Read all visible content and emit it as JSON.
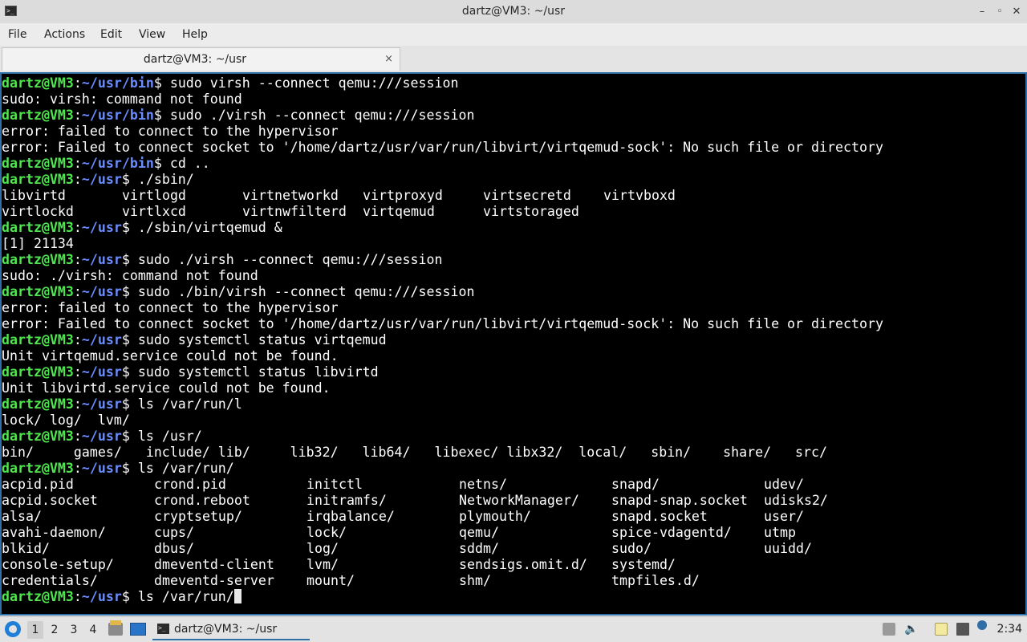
{
  "window": {
    "title": "dartz@VM3: ~/usr",
    "icon": "terminal-icon",
    "controls": [
      "minimize-icon",
      "maximize-icon",
      "close-icon"
    ]
  },
  "menu": {
    "file": "File",
    "actions": "Actions",
    "edit": "Edit",
    "view": "View",
    "help": "Help"
  },
  "tab": {
    "label": "dartz@VM3: ~/usr",
    "close": "×"
  },
  "terminal": {
    "lines": [
      {
        "type": "prompt",
        "user": "dartz@VM3",
        "path": "~/usr/bin",
        "cmd": "sudo virsh --connect qemu:///session"
      },
      {
        "type": "out",
        "text": "sudo: virsh: command not found"
      },
      {
        "type": "prompt",
        "user": "dartz@VM3",
        "path": "~/usr/bin",
        "cmd": "sudo ./virsh --connect qemu:///session"
      },
      {
        "type": "out",
        "text": "error: failed to connect to the hypervisor"
      },
      {
        "type": "out",
        "text": "error: Failed to connect socket to '/home/dartz/usr/var/run/libvirt/virtqemud-sock': No such file or directory"
      },
      {
        "type": "prompt",
        "user": "dartz@VM3",
        "path": "~/usr/bin",
        "cmd": "cd .."
      },
      {
        "type": "prompt",
        "user": "dartz@VM3",
        "path": "~/usr",
        "cmd": "./sbin/"
      },
      {
        "type": "cols",
        "width": 15,
        "items": [
          "libvirtd",
          "virtlogd",
          "virtnetworkd",
          "virtproxyd",
          "virtsecretd",
          "virtvboxd"
        ]
      },
      {
        "type": "cols",
        "width": 15,
        "items": [
          "virtlockd",
          "virtlxcd",
          "virtnwfilterd",
          "virtqemud",
          "virtstoraged"
        ]
      },
      {
        "type": "prompt",
        "user": "dartz@VM3",
        "path": "~/usr",
        "cmd": "./sbin/virtqemud &"
      },
      {
        "type": "out",
        "text": "[1] 21134"
      },
      {
        "type": "prompt",
        "user": "dartz@VM3",
        "path": "~/usr",
        "cmd": "sudo ./virsh --connect qemu:///session"
      },
      {
        "type": "out",
        "text": "sudo: ./virsh: command not found"
      },
      {
        "type": "prompt",
        "user": "dartz@VM3",
        "path": "~/usr",
        "cmd": "sudo ./bin/virsh --connect qemu:///session"
      },
      {
        "type": "out",
        "text": "error: failed to connect to the hypervisor"
      },
      {
        "type": "out",
        "text": "error: Failed to connect socket to '/home/dartz/usr/var/run/libvirt/virtqemud-sock': No such file or directory"
      },
      {
        "type": "prompt",
        "user": "dartz@VM3",
        "path": "~/usr",
        "cmd": "sudo systemctl status virtqemud"
      },
      {
        "type": "out",
        "text": "Unit virtqemud.service could not be found."
      },
      {
        "type": "prompt",
        "user": "dartz@VM3",
        "path": "~/usr",
        "cmd": "sudo systemctl status libvirtd"
      },
      {
        "type": "out",
        "text": "Unit libvirtd.service could not be found."
      },
      {
        "type": "prompt",
        "user": "dartz@VM3",
        "path": "~/usr",
        "cmd": "ls /var/run/l"
      },
      {
        "type": "out",
        "text": "lock/ log/  lvm/"
      },
      {
        "type": "prompt",
        "user": "dartz@VM3",
        "path": "~/usr",
        "cmd": "ls /usr/"
      },
      {
        "type": "out",
        "text": "bin/     games/   include/ lib/     lib32/   lib64/   libexec/ libx32/  local/   sbin/    share/   src/"
      },
      {
        "type": "prompt",
        "user": "dartz@VM3",
        "path": "~/usr",
        "cmd": "ls /var/run/"
      },
      {
        "type": "cols",
        "width": 19,
        "items": [
          "acpid.pid",
          "crond.pid",
          "initctl",
          "netns/",
          "snapd/",
          "udev/"
        ]
      },
      {
        "type": "cols",
        "width": 19,
        "items": [
          "acpid.socket",
          "crond.reboot",
          "initramfs/",
          "NetworkManager/",
          "snapd-snap.socket",
          "udisks2/"
        ]
      },
      {
        "type": "cols",
        "width": 19,
        "items": [
          "alsa/",
          "cryptsetup/",
          "irqbalance/",
          "plymouth/",
          "snapd.socket",
          "user/"
        ]
      },
      {
        "type": "cols",
        "width": 19,
        "items": [
          "avahi-daemon/",
          "cups/",
          "lock/",
          "qemu/",
          "spice-vdagentd/",
          "utmp"
        ]
      },
      {
        "type": "cols",
        "width": 19,
        "items": [
          "blkid/",
          "dbus/",
          "log/",
          "sddm/",
          "sudo/",
          "uuidd/"
        ]
      },
      {
        "type": "cols",
        "width": 19,
        "items": [
          "console-setup/",
          "dmeventd-client",
          "lvm/",
          "sendsigs.omit.d/",
          "systemd/"
        ]
      },
      {
        "type": "cols",
        "width": 19,
        "items": [
          "credentials/",
          "dmeventd-server",
          "mount/",
          "shm/",
          "tmpfiles.d/"
        ]
      },
      {
        "type": "prompt",
        "user": "dartz@VM3",
        "path": "~/usr",
        "cmd": "ls /var/run/",
        "cursor": true
      }
    ]
  },
  "taskbar": {
    "start_icon": "lxqt-start-icon",
    "workspaces": [
      "1",
      "2",
      "3",
      "4"
    ],
    "active_workspace": "1",
    "task_label": "dartz@VM3: ~/usr",
    "tray_icons": [
      "clipboard-icon",
      "volume-icon",
      "notes-icon",
      "network-icon",
      "info-icon"
    ],
    "clock": "2:34"
  },
  "colors": {
    "prompt_user": "#4fe64f",
    "prompt_path": "#6a8dff",
    "terminal_bg": "#000000",
    "terminal_fg": "#ffffff",
    "accent": "#2f6ea6"
  }
}
